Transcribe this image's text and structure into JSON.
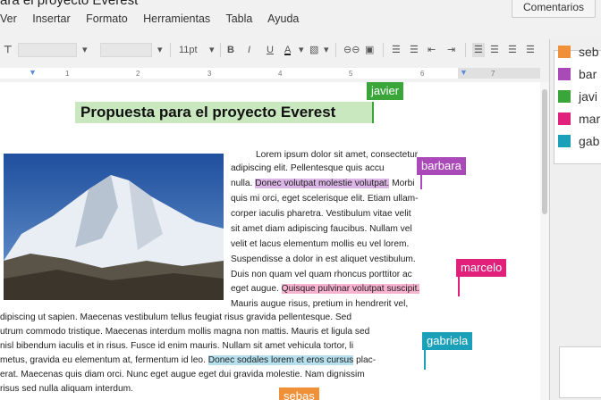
{
  "window": {
    "title": "ara el proyecto Everest"
  },
  "comments_button": "Comentarios",
  "menu": [
    "Ver",
    "Insertar",
    "Formato",
    "Herramientas",
    "Tabla",
    "Ayuda"
  ],
  "toolbar": {
    "font_size": "11pt",
    "bold": "B",
    "italic": "I",
    "underline": "U",
    "text_color": "A"
  },
  "ruler_ticks": [
    "1",
    "2",
    "3",
    "4",
    "5",
    "6",
    "7"
  ],
  "collaborators": [
    {
      "name": "seb",
      "color": "#f0913a"
    },
    {
      "name": "bar",
      "color": "#a94ab8"
    },
    {
      "name": "javi",
      "color": "#3aa63a"
    },
    {
      "name": "mar",
      "color": "#e0207a"
    },
    {
      "name": "gab",
      "color": "#1aa0b8"
    }
  ],
  "document": {
    "title": "Propuesta para el proyecto Everest",
    "body_lines": [
      "Lorem ipsum dolor sit amet, consectetur",
      "adipiscing elit. Pellentesque quis accu",
      [
        "nulla. ",
        "Donec volutpat molestie volutpat.",
        " Morbi"
      ],
      "quis mi orci, eget scelerisque elit. Etiam ullam-",
      "corper iaculis pharetra. Vestibulum vitae velit",
      "sit amet diam adipiscing faucibus. Nullam vel",
      "velit et lacus elementum mollis eu vel lorem.",
      "Suspendisse a dolor in est aliquet vestibulum.",
      "Duis non quam vel quam rhoncus porttitor ac",
      [
        "eget augue. ",
        "Quisque pulvinar volutpat suscipit."
      ],
      "Mauris augue risus, pretium in hendrerit vel,",
      "dipiscing ut sapien. Maecenas vestibulum tellus feugiat risus gravida pellentesque. Sed",
      "utrum commodo tristique. Maecenas interdum mollis magna non mattis. Mauris et ligula sed",
      "nisl bibendum iaculis et in risus. Fusce id enim mauris. Nullam sit amet vehicula tortor, li",
      "metus, gravida eu elementum at, fermentum id leo. ",
      [
        "Donec sodales lorem et eros cursus",
        " plac-"
      ],
      "erat. Maecenas quis diam orci. Nunc eget augue eget dui gravida molestie. Nam dignissim",
      "risus sed nulla aliquam interdum."
    ]
  },
  "cursors": [
    {
      "name": "javier",
      "color": "#3aa63a"
    },
    {
      "name": "barbara",
      "color": "#a94ab8"
    },
    {
      "name": "marcelo",
      "color": "#e0207a"
    },
    {
      "name": "gabriela",
      "color": "#1aa0b8"
    },
    {
      "name": "sebas",
      "color": "#f0913a"
    }
  ]
}
